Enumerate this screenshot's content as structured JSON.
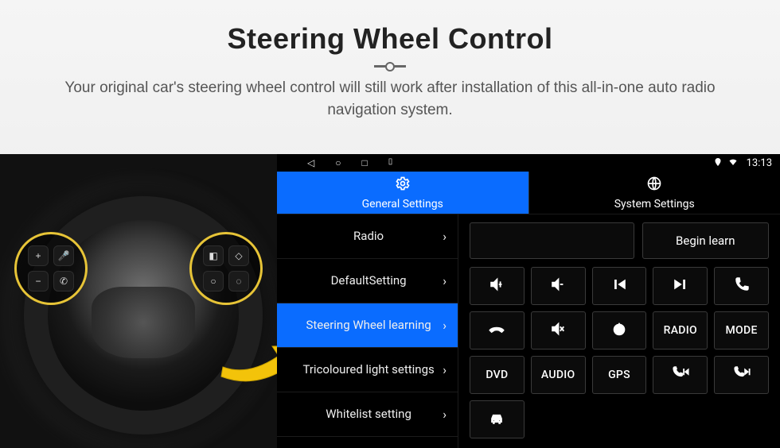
{
  "hero": {
    "title": "Steering Wheel Control",
    "subtitle": "Your original car's steering wheel control will still work after installation of this all-in-one auto radio navigation system."
  },
  "statusbar": {
    "time": "13:13"
  },
  "tabs": {
    "general": "General Settings",
    "system": "System Settings"
  },
  "menu": {
    "items": [
      {
        "label": "Radio"
      },
      {
        "label": "DefaultSetting"
      },
      {
        "label": "Steering Wheel learning"
      },
      {
        "label": "Tricoloured light settings"
      },
      {
        "label": "Whitelist setting"
      }
    ],
    "selected_index": 2
  },
  "actions": {
    "begin_learn": "Begin learn"
  },
  "grid": {
    "buttons": [
      {
        "name": "vol-up",
        "type": "icon"
      },
      {
        "name": "vol-down",
        "type": "icon"
      },
      {
        "name": "prev-track",
        "type": "icon"
      },
      {
        "name": "next-track",
        "type": "icon"
      },
      {
        "name": "call-answer",
        "type": "icon"
      },
      {
        "name": "call-end",
        "type": "icon"
      },
      {
        "name": "mute",
        "type": "icon"
      },
      {
        "name": "power",
        "type": "icon"
      },
      {
        "name": "radio",
        "type": "text",
        "label": "RADIO"
      },
      {
        "name": "mode",
        "type": "text",
        "label": "MODE"
      },
      {
        "name": "dvd",
        "type": "text",
        "label": "DVD"
      },
      {
        "name": "audio",
        "type": "text",
        "label": "AUDIO"
      },
      {
        "name": "gps",
        "type": "text",
        "label": "GPS"
      },
      {
        "name": "call-prev",
        "type": "icon"
      },
      {
        "name": "call-next",
        "type": "icon"
      },
      {
        "name": "car",
        "type": "icon"
      }
    ]
  }
}
